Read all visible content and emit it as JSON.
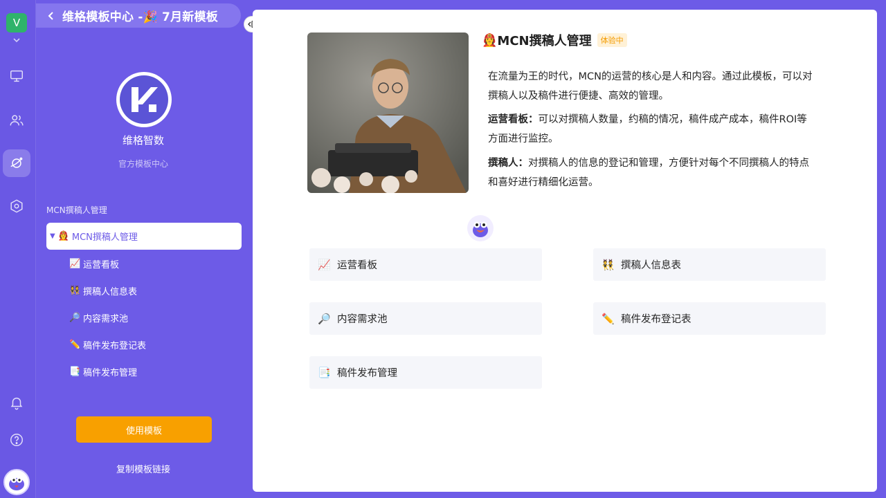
{
  "rail": {
    "workspace_initial": "V"
  },
  "sidebar": {
    "title": "维格模板中心 -🎉 7月新模板",
    "brand_name": "维格智数",
    "brand_subtitle": "官方模板中心",
    "section_label": "MCN撰稿人管理",
    "root_item": {
      "emoji": "👩‍🚒",
      "label": "MCN撰稿人管理"
    },
    "items": [
      {
        "emoji": "📈",
        "label": "运营看板"
      },
      {
        "emoji": "👯",
        "label": "撰稿人信息表"
      },
      {
        "emoji": "🔎",
        "label": "内容需求池"
      },
      {
        "emoji": "✏️",
        "label": "稿件发布登记表"
      },
      {
        "emoji": "📑",
        "label": "稿件发布管理"
      }
    ],
    "use_button": "使用模板",
    "copy_link": "复制模板链接"
  },
  "content": {
    "title_emoji": "👩‍🚒",
    "title": "MCN撰稿人管理",
    "badge": "体验中",
    "intro": "在流量为王的时代，MCN的运营的核心是人和内容。通过此模板，可以对撰稿人以及稿件进行便捷、高效的管理。",
    "dashboard_label": "运营看板：",
    "dashboard_text": "可以对撰稿人数量，约稿的情况，稿件成产成本，稿件ROI等方面进行监控。",
    "writer_label": "撰稿人：",
    "writer_text": "对撰稿人的信息的登记和管理，方便针对每个不同撰稿人的特点和喜好进行精细化运营。",
    "cards": [
      {
        "emoji": "📈",
        "label": "运营看板"
      },
      {
        "emoji": "👯",
        "label": "撰稿人信息表"
      },
      {
        "emoji": "🔎",
        "label": "内容需求池"
      },
      {
        "emoji": "✏️",
        "label": "稿件发布登记表"
      },
      {
        "emoji": "📑",
        "label": "稿件发布管理"
      }
    ]
  },
  "colors": {
    "brand_purple": "#6d5be7",
    "orange": "#f8a000"
  }
}
